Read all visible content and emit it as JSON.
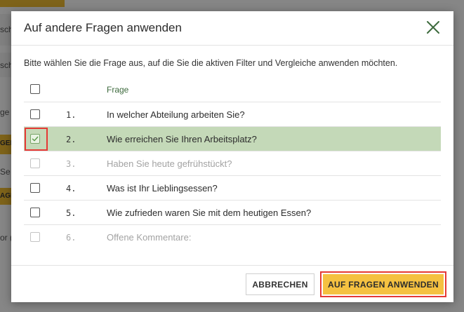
{
  "background": {
    "fragments": [
      "sch",
      "sch",
      "ge",
      "GEN",
      "Se",
      "AGE",
      "or ("
    ]
  },
  "dialog": {
    "title": "Auf andere Fragen anwenden",
    "close_icon": "close-icon",
    "instructions": "Bitte wählen Sie die Frage aus, auf die Sie die aktiven Filter und Vergleiche anwenden möchten.",
    "column_header": "Frage",
    "questions": [
      {
        "number": "1.",
        "text": "In welcher Abteilung arbeiten Sie?",
        "checked": false,
        "disabled": false
      },
      {
        "number": "2.",
        "text": "Wie erreichen Sie Ihren Arbeitsplatz?",
        "checked": true,
        "disabled": false
      },
      {
        "number": "3.",
        "text": "Haben Sie heute gefrühstückt?",
        "checked": false,
        "disabled": true
      },
      {
        "number": "4.",
        "text": "Was ist Ihr Lieblingsessen?",
        "checked": false,
        "disabled": false
      },
      {
        "number": "5.",
        "text": "Wie zufrieden waren Sie mit dem heutigen Essen?",
        "checked": false,
        "disabled": false
      },
      {
        "number": "6.",
        "text": "Offene Kommentare:",
        "checked": false,
        "disabled": true
      }
    ],
    "cancel_label": "ABBRECHEN",
    "apply_label": "AUF FRAGEN ANWENDEN"
  },
  "colors": {
    "accent": "#f5c141",
    "selected_row": "#c4d9b8",
    "highlight": "#e53935",
    "header_text": "#3d6a3d"
  }
}
